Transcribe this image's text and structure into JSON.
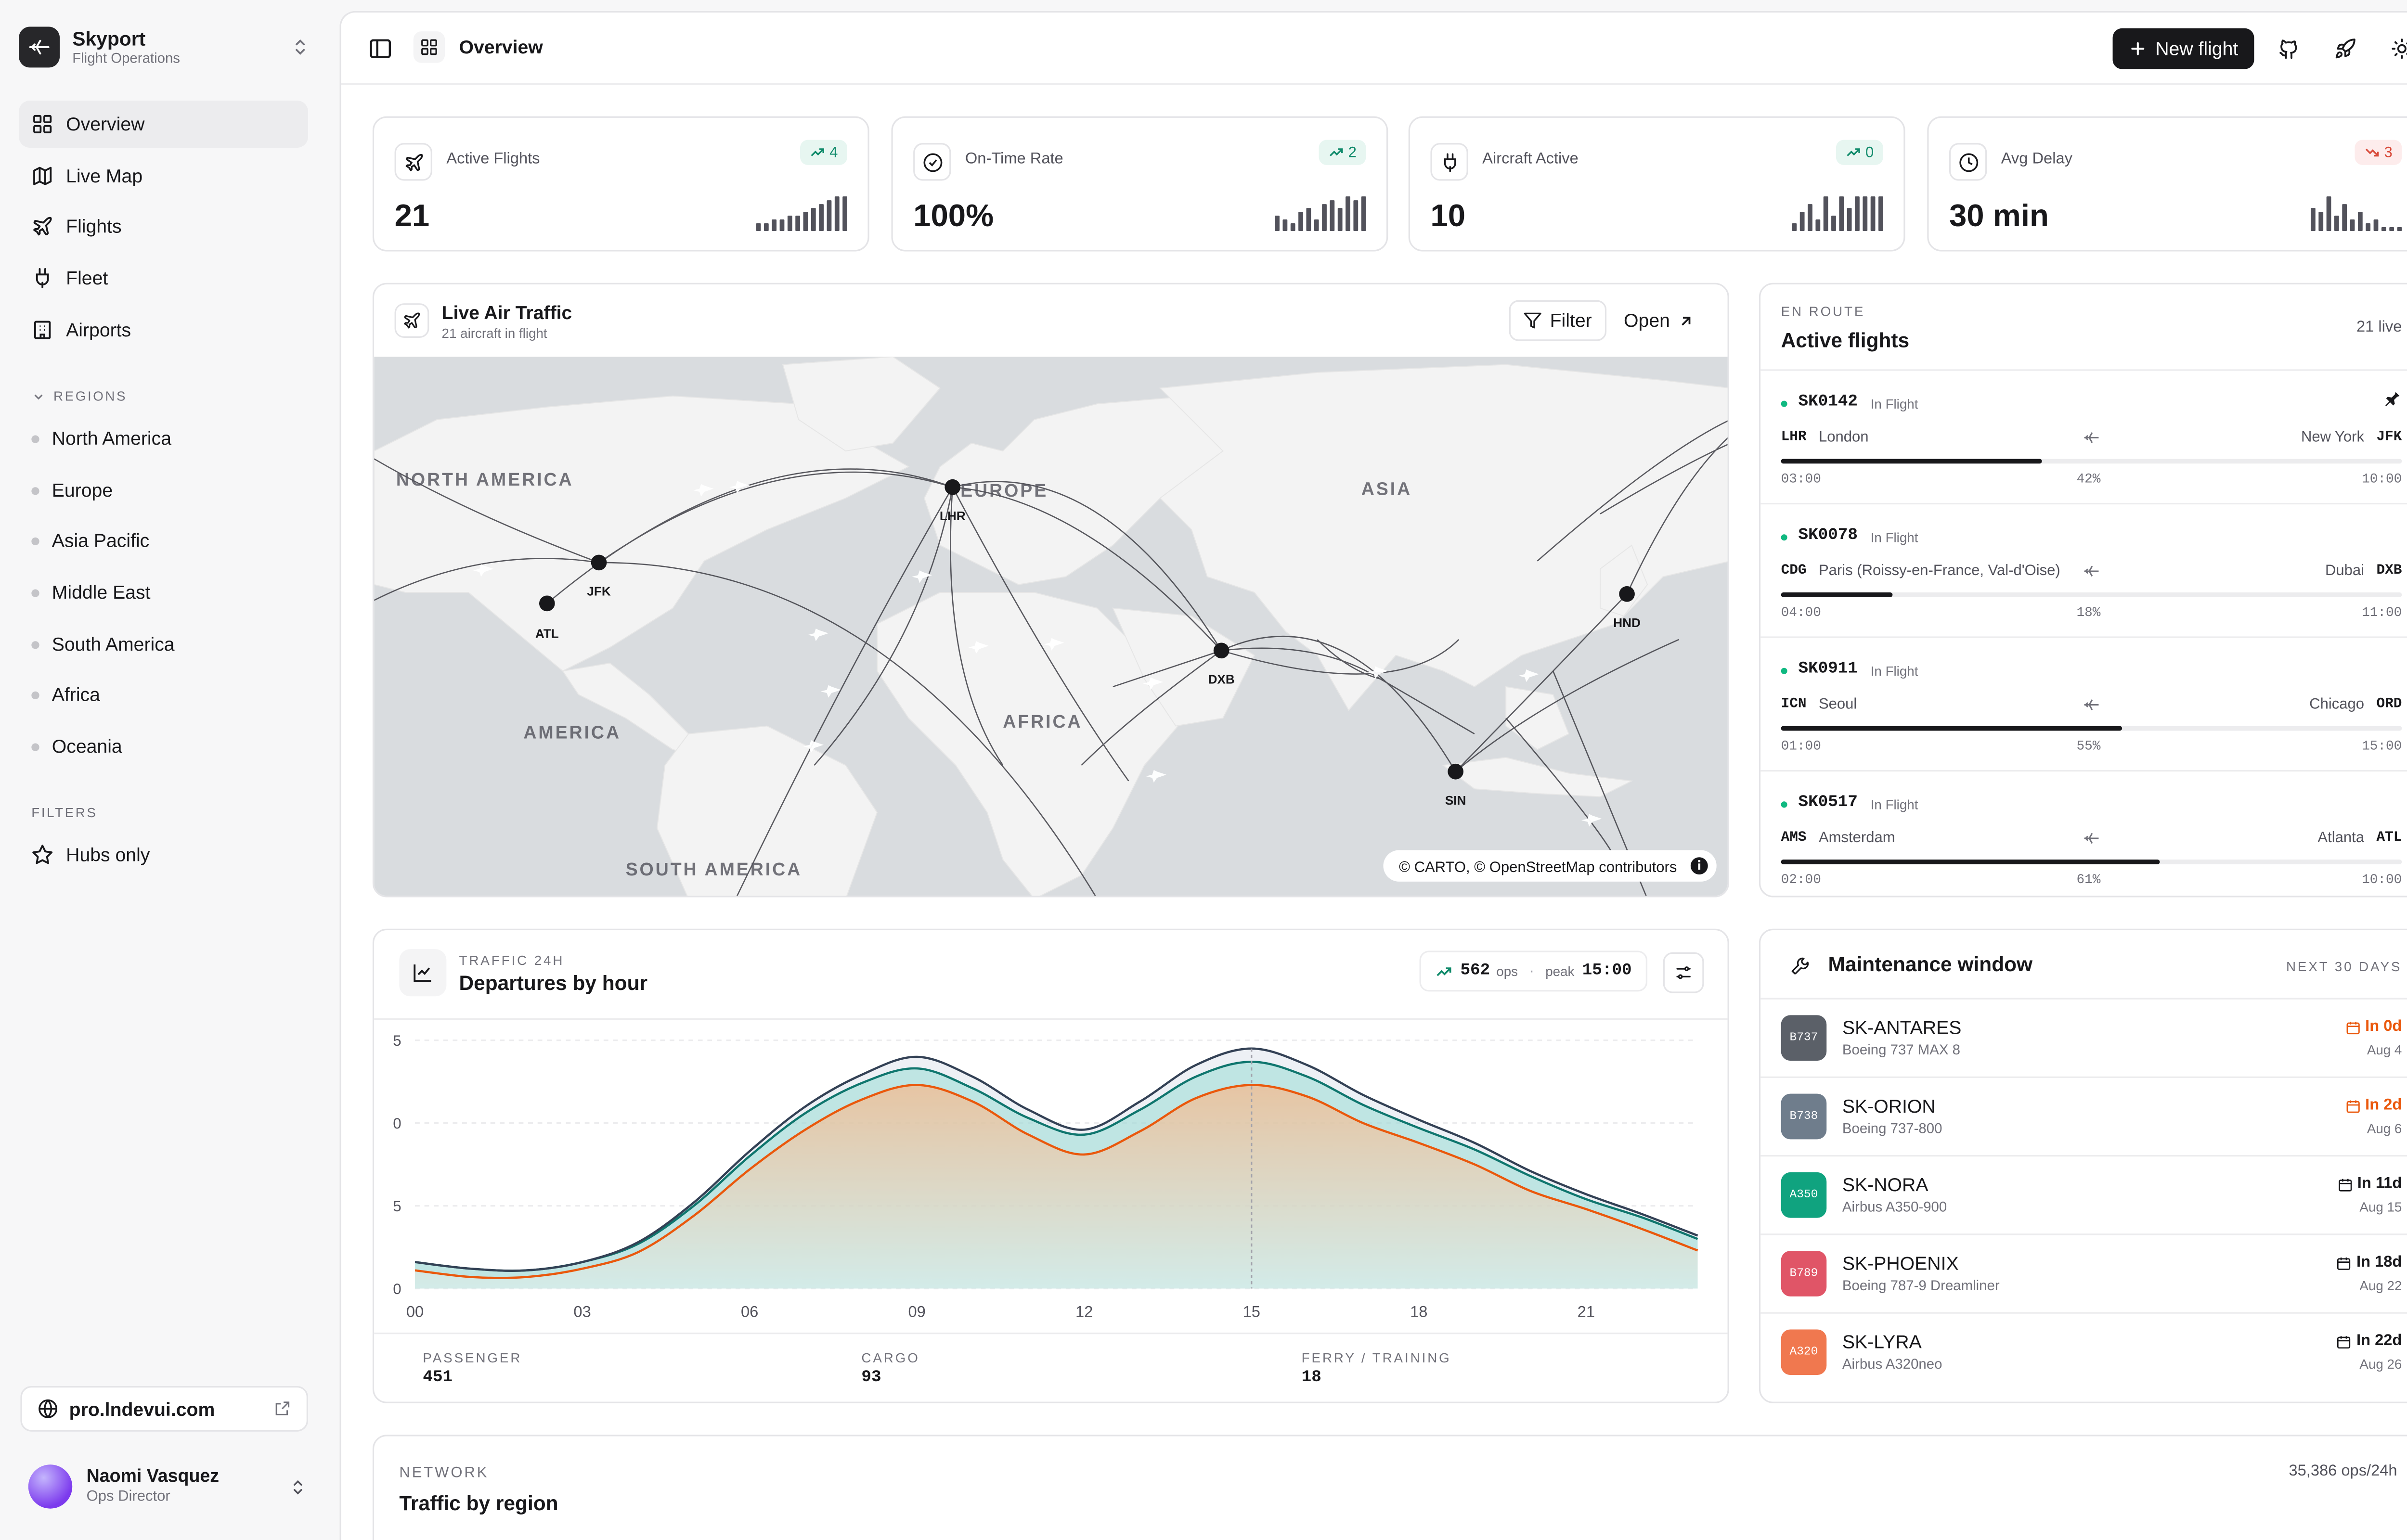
{
  "brand": {
    "name": "Skyport",
    "subtitle": "Flight Operations"
  },
  "nav": [
    {
      "label": "Overview",
      "icon": "grid-icon",
      "active": true
    },
    {
      "label": "Live Map",
      "icon": "map-icon",
      "active": false
    },
    {
      "label": "Flights",
      "icon": "plane-icon",
      "active": false
    },
    {
      "label": "Fleet",
      "icon": "plug-icon",
      "active": false
    },
    {
      "label": "Airports",
      "icon": "building-icon",
      "active": false
    }
  ],
  "regions_label": "REGIONS",
  "regions": [
    "North America",
    "Europe",
    "Asia Pacific",
    "Middle East",
    "South America",
    "Africa",
    "Oceania"
  ],
  "filters_label": "FILTERS",
  "filters": {
    "hubs_only": "Hubs only"
  },
  "site_link": "pro.lndevui.com",
  "user": {
    "name": "Naomi Vasquez",
    "role": "Ops Director"
  },
  "header": {
    "title": "Overview",
    "new_flight": "New flight"
  },
  "kpis": [
    {
      "label": "Active Flights",
      "value": "21",
      "delta": "4",
      "dir": "up",
      "icon": "plane-icon",
      "spark": [
        2,
        2,
        3,
        3,
        4,
        4,
        5,
        6,
        7,
        8,
        9,
        9
      ]
    },
    {
      "label": "On-Time Rate",
      "value": "100%",
      "delta": "2",
      "dir": "up",
      "icon": "check-circle-icon",
      "spark": [
        4,
        3,
        2,
        5,
        6,
        3,
        7,
        8,
        6,
        9,
        8,
        9
      ]
    },
    {
      "label": "Aircraft Active",
      "value": "10",
      "delta": "0",
      "dir": "up",
      "icon": "plug-icon",
      "spark": [
        2,
        5,
        7,
        3,
        9,
        4,
        9,
        6,
        9,
        9,
        9,
        9
      ]
    },
    {
      "label": "Avg Delay",
      "value": "30 min",
      "delta": "3",
      "dir": "down",
      "icon": "clock-icon",
      "spark": [
        6,
        5,
        9,
        4,
        7,
        3,
        5,
        2,
        3,
        1,
        1,
        1
      ]
    }
  ],
  "live_traffic": {
    "title": "Live Air Traffic",
    "subtitle": "21 aircraft in flight",
    "filter": "Filter",
    "open": "Open",
    "attribution": "© CARTO, © OpenStreetMap contributors",
    "continent_labels": {
      "north_america": "NORTH AMERICA",
      "europe": "EUROPE",
      "asia": "ASIA",
      "africa": "AFRICA",
      "america": "AMERICA",
      "south_america": "SOUTH AMERICA"
    },
    "airports": [
      {
        "code": "JFK"
      },
      {
        "code": "ATL"
      },
      {
        "code": "LHR"
      },
      {
        "code": "DXB"
      },
      {
        "code": "HND"
      },
      {
        "code": "SIN"
      }
    ]
  },
  "active_flights": {
    "eyebrow": "EN ROUTE",
    "title": "Active flights",
    "count": "21 live",
    "items": [
      {
        "code": "SK0142",
        "status": "In Flight",
        "from": "LHR",
        "from_city": "London",
        "to": "JFK",
        "to_city": "New York",
        "dep": "03:00",
        "arr": "10:00",
        "progress_label": "42%",
        "progress": 0.42
      },
      {
        "code": "SK0078",
        "status": "In Flight",
        "from": "CDG",
        "from_city": "Paris (Roissy-en-France, Val-d'Oise)",
        "to": "DXB",
        "to_city": "Dubai",
        "dep": "04:00",
        "arr": "11:00",
        "progress_label": "18%",
        "progress": 0.18
      },
      {
        "code": "SK0911",
        "status": "In Flight",
        "from": "ICN",
        "from_city": "Seoul",
        "to": "ORD",
        "to_city": "Chicago",
        "dep": "01:00",
        "arr": "15:00",
        "progress_label": "55%",
        "progress": 0.55
      },
      {
        "code": "SK0517",
        "status": "In Flight",
        "from": "AMS",
        "from_city": "Amsterdam",
        "to": "ATL",
        "to_city": "Atlanta",
        "dep": "02:00",
        "arr": "10:00",
        "progress_label": "61%",
        "progress": 0.61
      }
    ]
  },
  "departures": {
    "eyebrow": "TRAFFIC 24H",
    "title": "Departures by hour",
    "ops_value": "562",
    "ops_unit": "ops",
    "peak_label": "peak",
    "peak_value": "15:00",
    "footer": [
      {
        "label": "PASSENGER",
        "value": "451"
      },
      {
        "label": "CARGO",
        "value": "93"
      },
      {
        "label": "FERRY / TRAINING",
        "value": "18"
      }
    ]
  },
  "maintenance": {
    "title": "Maintenance window",
    "range": "NEXT 30 DAYS",
    "items": [
      {
        "badge": "B737",
        "color": "#5b6068",
        "name": "SK-ANTARES",
        "model": "Boeing 737 MAX 8",
        "due": "In 0d",
        "date": "Aug 4",
        "urgent": true
      },
      {
        "badge": "B738",
        "color": "#6f7d8c",
        "name": "SK-ORION",
        "model": "Boeing 737-800",
        "due": "In 2d",
        "date": "Aug 6",
        "urgent": true
      },
      {
        "badge": "A350",
        "color": "#10a37f",
        "name": "SK-NORA",
        "model": "Airbus A350-900",
        "due": "In 11d",
        "date": "Aug 15",
        "urgent": false
      },
      {
        "badge": "B789",
        "color": "#e05567",
        "name": "SK-PHOENIX",
        "model": "Boeing 787-9 Dreamliner",
        "due": "In 18d",
        "date": "Aug 22",
        "urgent": false
      },
      {
        "badge": "A320",
        "color": "#f0784f",
        "name": "SK-LYRA",
        "model": "Airbus A320neo",
        "due": "In 22d",
        "date": "Aug 26",
        "urgent": false
      }
    ]
  },
  "network": {
    "eyebrow": "NETWORK",
    "title": "Traffic by region",
    "total": "35,386 ops/24h"
  },
  "chart_data": {
    "type": "area",
    "title": "Departures by hour",
    "x": [
      0,
      1,
      2,
      3,
      4,
      5,
      6,
      7,
      8,
      9,
      10,
      11,
      12,
      13,
      14,
      15,
      16,
      17,
      18,
      19,
      20,
      21,
      22,
      23
    ],
    "x_ticks": [
      "00",
      "03",
      "06",
      "09",
      "12",
      "15",
      "18",
      "21"
    ],
    "y_ticks": [
      "5",
      "0",
      "5",
      "0"
    ],
    "series": [
      {
        "color": "#ea580c",
        "values": [
          1.1,
          0.7,
          0.7,
          1.2,
          2.2,
          4.4,
          7.2,
          9.6,
          11.4,
          12.3,
          11.3,
          9.3,
          8.1,
          9.5,
          11.5,
          12.3,
          11.6,
          10.0,
          8.8,
          7.5,
          5.9,
          4.8,
          3.6,
          2.3
        ]
      },
      {
        "color": "#0f766e",
        "values": [
          1.6,
          1.2,
          1.1,
          1.6,
          2.7,
          5.0,
          8.0,
          10.6,
          12.4,
          13.3,
          12.1,
          10.3,
          9.3,
          10.8,
          12.8,
          13.7,
          12.8,
          11.1,
          9.7,
          8.4,
          6.8,
          5.4,
          4.3,
          3.0
        ]
      },
      {
        "color": "#334155",
        "values": [
          1.6,
          1.2,
          1.1,
          1.6,
          2.8,
          5.2,
          8.3,
          11.0,
          12.9,
          14.0,
          12.8,
          10.8,
          9.6,
          11.3,
          13.5,
          14.5,
          13.5,
          11.7,
          10.2,
          8.8,
          7.1,
          5.7,
          4.5,
          3.2
        ]
      }
    ],
    "peak_x": 15,
    "ylim": [
      0,
      15
    ],
    "grid": true
  }
}
